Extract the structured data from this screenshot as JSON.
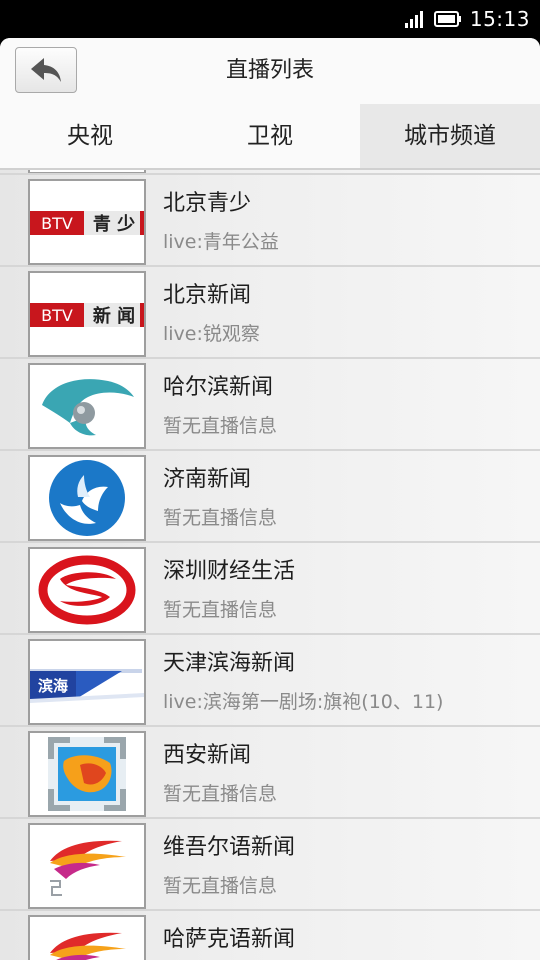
{
  "status_bar": {
    "time": "15:13"
  },
  "header": {
    "title": "直播列表"
  },
  "tabs": [
    {
      "label": "央视"
    },
    {
      "label": "卫视"
    },
    {
      "label": "城市频道"
    }
  ],
  "channels": [
    {
      "name": "北京青少",
      "info": "live:青年公益",
      "logo_text": "青 少",
      "logo_brand": "BTV"
    },
    {
      "name": "北京新闻",
      "info": "live:锐观察",
      "logo_text": "新 闻",
      "logo_brand": "BTV"
    },
    {
      "name": "哈尔滨新闻",
      "info": "暂无直播信息"
    },
    {
      "name": "济南新闻",
      "info": "暂无直播信息"
    },
    {
      "name": "深圳财经生活",
      "info": "暂无直播信息"
    },
    {
      "name": "天津滨海新闻",
      "info": "live:滨海第一剧场:旗袍(10、11)",
      "logo_text": "滨海"
    },
    {
      "name": "西安新闻",
      "info": "暂无直播信息"
    },
    {
      "name": "维吾尔语新闻",
      "info": "暂无直播信息"
    },
    {
      "name": "哈萨克语新闻",
      "info": ""
    }
  ],
  "colors": {
    "btv_red": "#c8161d",
    "accent_blue": "#1b78c8",
    "teal": "#3aa6b3"
  }
}
